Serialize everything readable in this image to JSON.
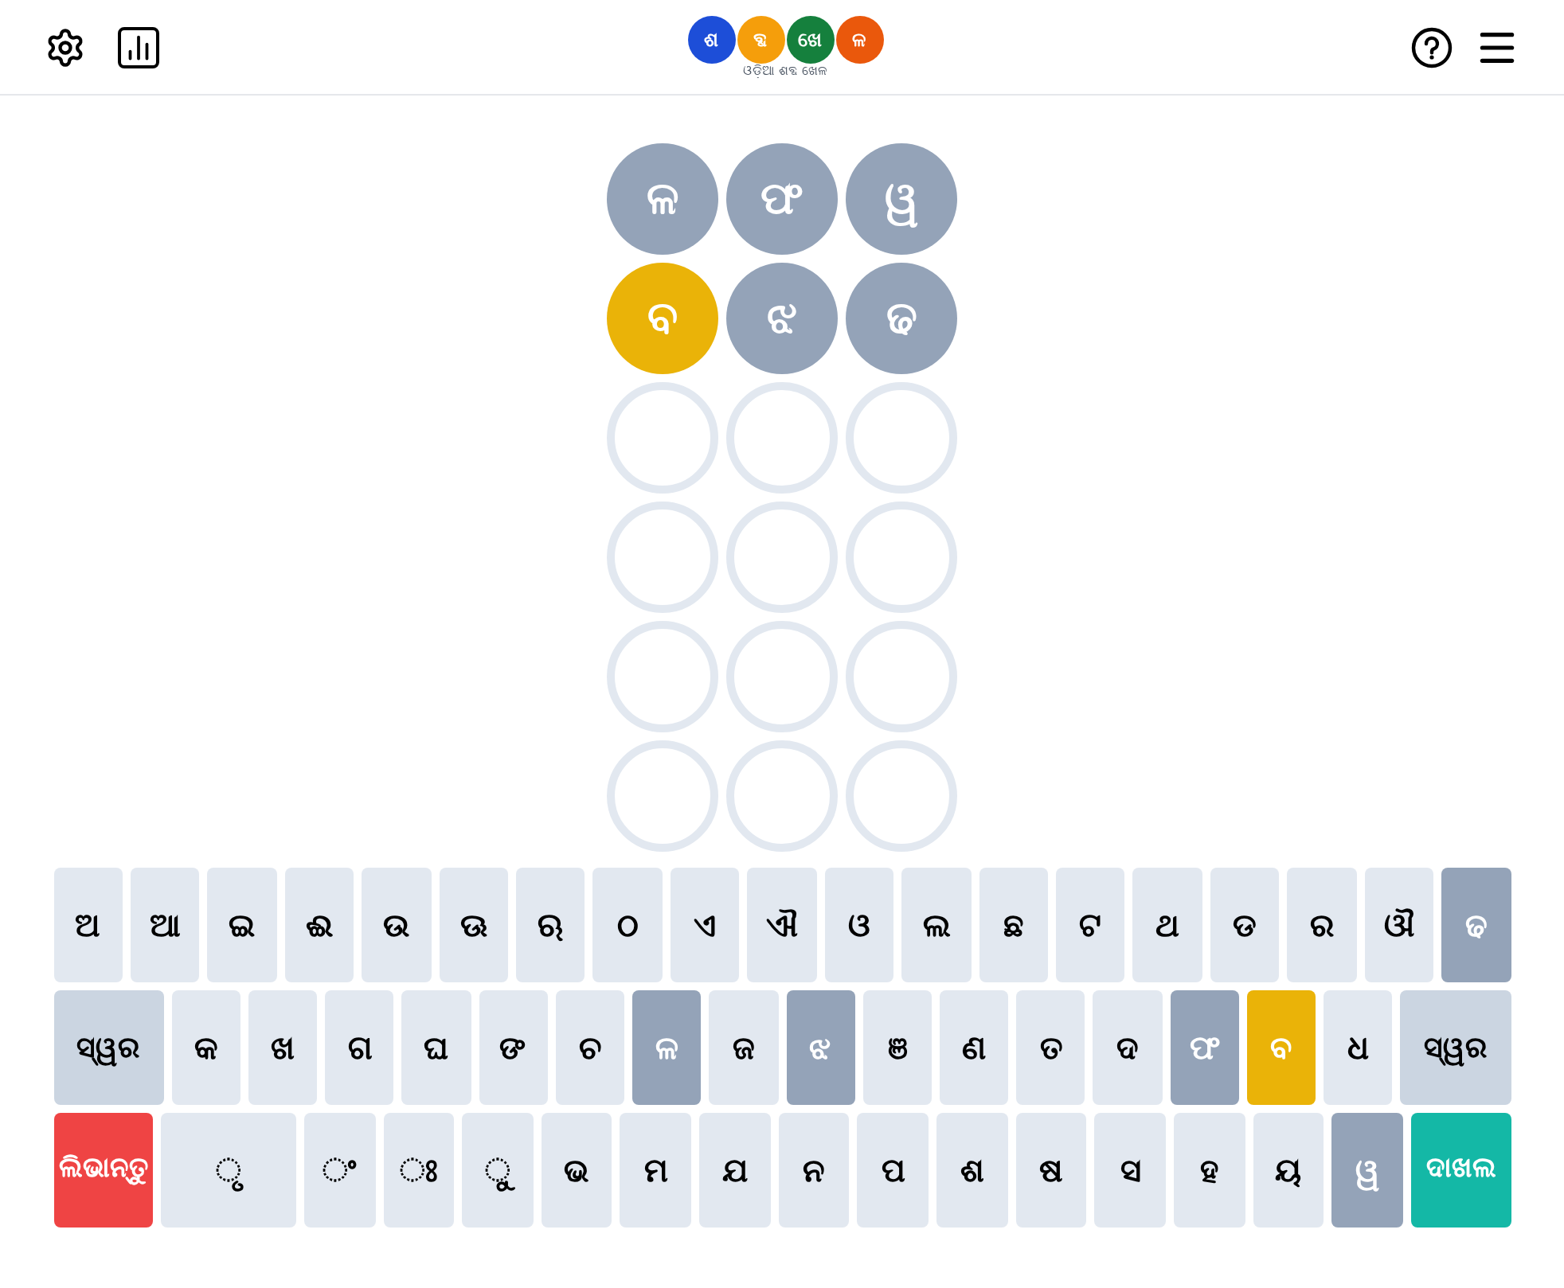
{
  "logo": {
    "letters": [
      {
        "text": "ଶ",
        "color": "#1d4ed8"
      },
      {
        "text": "ବ୍ଦ",
        "color": "#f59e0b"
      },
      {
        "text": "ଖେ",
        "color": "#15803d"
      },
      {
        "text": "ଳ",
        "color": "#ea580c"
      }
    ],
    "subtitle": "ଓଡ଼ିଆ ଶବ୍ଦ ଖେଳ"
  },
  "grid": [
    [
      {
        "letter": "ଳ",
        "absent": true,
        "present": false
      },
      {
        "letter": "ଫ",
        "absent": true,
        "present": false
      },
      {
        "letter": "ୱ",
        "absent": true,
        "present": false
      }
    ],
    [
      {
        "letter": "ବ",
        "absent": false,
        "present": true
      },
      {
        "letter": "ଝ",
        "absent": true,
        "present": false
      },
      {
        "letter": "ଢ",
        "absent": true,
        "present": false
      }
    ],
    [
      {
        "absent": false,
        "present": false
      },
      {
        "absent": false,
        "present": false
      },
      {
        "absent": false,
        "present": false
      }
    ],
    [
      {
        "absent": false,
        "present": false
      },
      {
        "absent": false,
        "present": false
      },
      {
        "absent": false,
        "present": false
      }
    ],
    [
      {
        "absent": false,
        "present": false
      },
      {
        "absent": false,
        "present": false
      },
      {
        "absent": false,
        "present": false
      }
    ],
    [
      {
        "absent": false,
        "present": false
      },
      {
        "absent": false,
        "present": false
      },
      {
        "absent": false,
        "present": false
      }
    ]
  ],
  "keyboard": [
    [
      {
        "label": "ଅ",
        "kind": "char",
        "absent": false,
        "present": false
      },
      {
        "label": "ଆ",
        "kind": "char",
        "absent": false,
        "present": false
      },
      {
        "label": "ଇ",
        "kind": "char",
        "absent": false,
        "present": false
      },
      {
        "label": "ଈ",
        "kind": "char",
        "absent": false,
        "present": false
      },
      {
        "label": "ଉ",
        "kind": "char",
        "absent": false,
        "present": false
      },
      {
        "label": "ଊ",
        "kind": "char",
        "absent": false,
        "present": false
      },
      {
        "label": "ଋ",
        "kind": "char",
        "absent": false,
        "present": false
      },
      {
        "label": "ଠ",
        "kind": "char",
        "absent": false,
        "present": false
      },
      {
        "label": "ଏ",
        "kind": "char",
        "absent": false,
        "present": false
      },
      {
        "label": "ଐ",
        "kind": "char",
        "absent": false,
        "present": false
      },
      {
        "label": "ଓ",
        "kind": "char",
        "absent": false,
        "present": false
      },
      {
        "label": "ଲ",
        "kind": "char",
        "absent": false,
        "present": false
      },
      {
        "label": "ଛ",
        "kind": "char",
        "absent": false,
        "present": false
      },
      {
        "label": "ଟ",
        "kind": "char",
        "absent": false,
        "present": false
      },
      {
        "label": "ଥ",
        "kind": "char",
        "absent": false,
        "present": false
      },
      {
        "label": "ଡ",
        "kind": "char",
        "absent": false,
        "present": false
      },
      {
        "label": "ର",
        "kind": "char",
        "absent": false,
        "present": false
      },
      {
        "label": "ଔ",
        "kind": "char",
        "absent": false,
        "present": false
      },
      {
        "label": "ଢ",
        "kind": "char",
        "absent": true,
        "present": false
      }
    ],
    [
      {
        "label": "ସ୍ୱର",
        "kind": "wide",
        "absent": false,
        "present": false
      },
      {
        "label": "କ",
        "kind": "char",
        "absent": false,
        "present": false
      },
      {
        "label": "ଖ",
        "kind": "char",
        "absent": false,
        "present": false
      },
      {
        "label": "ଗ",
        "kind": "char",
        "absent": false,
        "present": false
      },
      {
        "label": "ଘ",
        "kind": "char",
        "absent": false,
        "present": false
      },
      {
        "label": "ଙ",
        "kind": "char",
        "absent": false,
        "present": false
      },
      {
        "label": "ଚ",
        "kind": "char",
        "absent": false,
        "present": false
      },
      {
        "label": "ଳ",
        "kind": "char",
        "absent": true,
        "present": false
      },
      {
        "label": "ଜ",
        "kind": "char",
        "absent": false,
        "present": false
      },
      {
        "label": "ଝ",
        "kind": "char",
        "absent": true,
        "present": false
      },
      {
        "label": "ଞ",
        "kind": "char",
        "absent": false,
        "present": false
      },
      {
        "label": "ଣ",
        "kind": "char",
        "absent": false,
        "present": false
      },
      {
        "label": "ତ",
        "kind": "char",
        "absent": false,
        "present": false
      },
      {
        "label": "ଦ",
        "kind": "char",
        "absent": false,
        "present": false
      },
      {
        "label": "ଫ",
        "kind": "char",
        "absent": true,
        "present": false
      },
      {
        "label": "ବ",
        "kind": "char",
        "absent": false,
        "present": true
      },
      {
        "label": "ଧ",
        "kind": "char",
        "absent": false,
        "present": false
      },
      {
        "label": "ସ୍ୱର",
        "kind": "wide",
        "absent": false,
        "present": false
      }
    ],
    [
      {
        "label": "ଲିଭାନ୍ତୁ",
        "kind": "delete"
      },
      {
        "label": "ୃ",
        "kind": "wide-char",
        "absent": false,
        "present": false
      },
      {
        "label": "ଂ",
        "kind": "char",
        "absent": false,
        "present": false
      },
      {
        "label": "ଃ",
        "kind": "char",
        "absent": false,
        "present": false
      },
      {
        "label": "ୁ",
        "kind": "char",
        "absent": false,
        "present": false
      },
      {
        "label": "ଭ",
        "kind": "char",
        "absent": false,
        "present": false
      },
      {
        "label": "ମ",
        "kind": "char",
        "absent": false,
        "present": false
      },
      {
        "label": "ଯ",
        "kind": "char",
        "absent": false,
        "present": false
      },
      {
        "label": "ନ",
        "kind": "char",
        "absent": false,
        "present": false
      },
      {
        "label": "ପ",
        "kind": "char",
        "absent": false,
        "present": false
      },
      {
        "label": "ଶ",
        "kind": "char",
        "absent": false,
        "present": false
      },
      {
        "label": "ଷ",
        "kind": "char",
        "absent": false,
        "present": false
      },
      {
        "label": "ସ",
        "kind": "char",
        "absent": false,
        "present": false
      },
      {
        "label": "ହ",
        "kind": "char",
        "absent": false,
        "present": false
      },
      {
        "label": "ୟ",
        "kind": "char",
        "absent": false,
        "present": false
      },
      {
        "label": "ୱ",
        "kind": "char",
        "absent": true,
        "present": false
      },
      {
        "label": "ଦାଖଲ",
        "kind": "enter"
      }
    ]
  ]
}
